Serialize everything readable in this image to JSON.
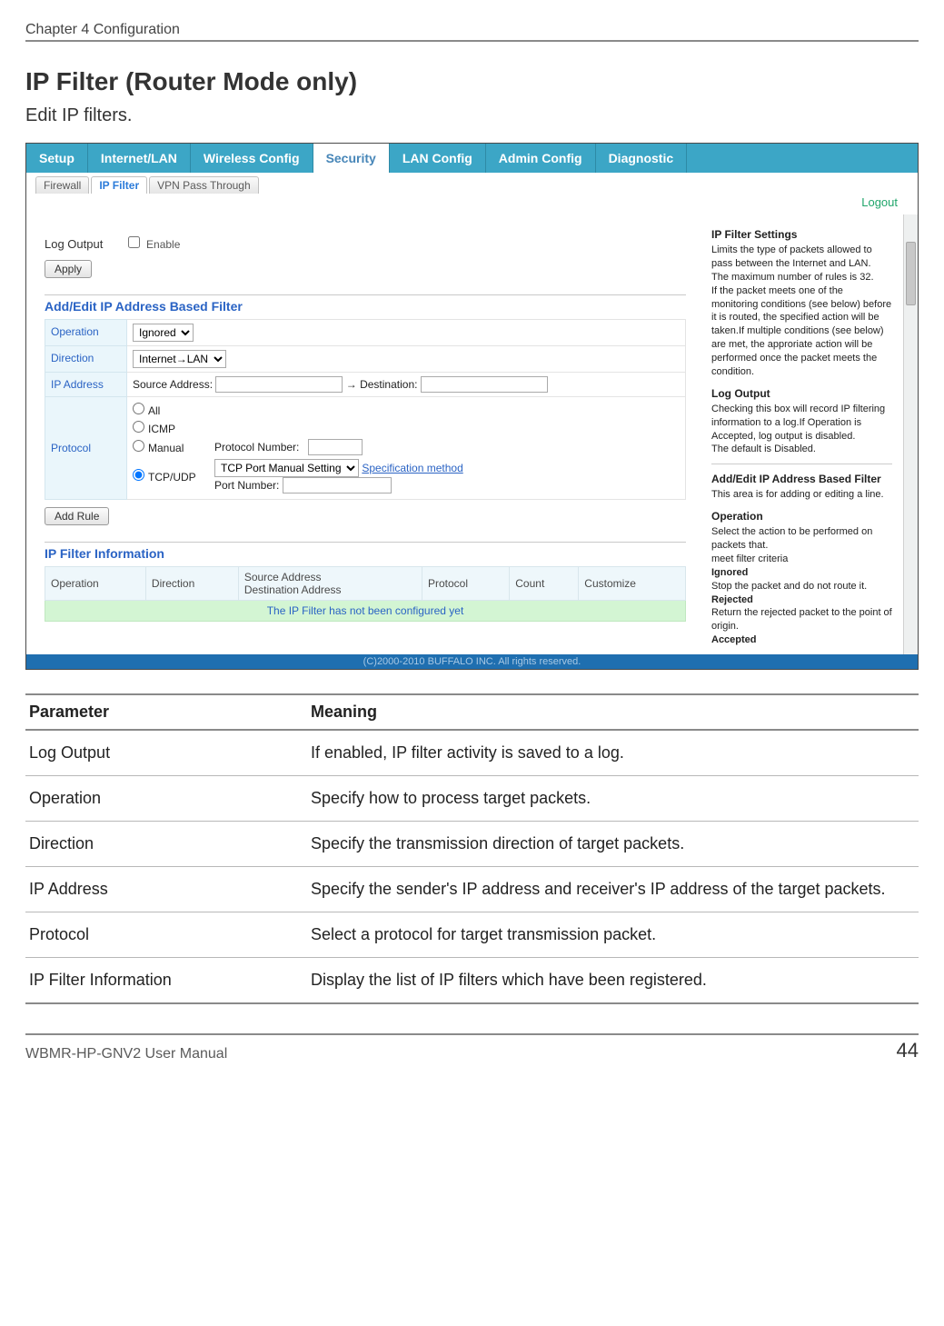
{
  "chapter": "Chapter 4  Configuration",
  "section_title": "IP Filter (Router Mode only)",
  "section_sub": "Edit IP filters.",
  "tabs": {
    "setup": "Setup",
    "internet_lan": "Internet/LAN",
    "wireless": "Wireless Config",
    "security": "Security",
    "lan": "LAN Config",
    "admin": "Admin Config",
    "diag": "Diagnostic"
  },
  "subtabs": {
    "firewall": "Firewall",
    "ipfilter": "IP Filter",
    "vpn": "VPN Pass Through"
  },
  "logout": "Logout",
  "form": {
    "log_output_label": "Log Output",
    "enable_label": "Enable",
    "apply": "Apply",
    "add_edit_head": "Add/Edit IP Address Based Filter",
    "operation_label": "Operation",
    "operation_value": "Ignored",
    "direction_label": "Direction",
    "direction_value": "Internet→LAN",
    "ipaddress_label": "IP Address",
    "source_label": "Source Address:",
    "dest_label": "→ Destination:",
    "protocol_label": "Protocol",
    "all": "All",
    "icmp": "ICMP",
    "manual": "Manual",
    "protocol_number": "Protocol Number:",
    "tcpudp": "TCP/UDP",
    "tcp_select": "TCP Port Manual Setting",
    "spec_method": "Specification method",
    "port_number": "Port Number:",
    "add_rule": "Add Rule",
    "info_head": "IP Filter Information",
    "cols": {
      "operation": "Operation",
      "direction": "Direction",
      "src_dest": "Source Address\nDestination Address",
      "protocol": "Protocol",
      "count": "Count",
      "customize": "Customize"
    },
    "not_configured": "The IP Filter has not been configured yet"
  },
  "help": {
    "h1": "IP Filter Settings",
    "p1": "Limits the type of packets allowed to pass between the Internet and LAN.",
    "p2": "The maximum number of rules is 32.",
    "p3": "If the packet meets one of the monitoring conditions (see below) before it is routed, the specified action will be taken.If multiple conditions (see below) are met, the approriate action will be performed once the packet meets the condition.",
    "h2": "Log Output",
    "p4": "Checking this box will record IP filtering information to a log.If Operation is Accepted, log output is disabled.",
    "p5": "The default is Disabled.",
    "h3": "Add/Edit IP Address Based Filter",
    "p6": "This area is for adding or editing a line.",
    "h4": "Operation",
    "p7": "Select the action to be performed on packets that.",
    "p7b": "meet filter criteria",
    "ig": "Ignored",
    "igd": "Stop the packet and do not route it.",
    "rj": "Rejected",
    "rjd": "Return the rejected packet to the point of origin.",
    "ac": "Accepted"
  },
  "copyright": "(C)2000-2010 BUFFALO INC. All rights reserved.",
  "param_table": {
    "head_param": "Parameter",
    "head_meaning": "Meaning",
    "rows": [
      {
        "p": "Log Output",
        "m": "If enabled, IP filter activity is saved to a log."
      },
      {
        "p": "Operation",
        "m": "Specify how to process target packets."
      },
      {
        "p": "Direction",
        "m": "Specify the transmission direction of target packets."
      },
      {
        "p": "IP Address",
        "m": "Specify the sender's IP address and receiver's IP address of the target packets."
      },
      {
        "p": "Protocol",
        "m": "Select a protocol for target transmission packet."
      },
      {
        "p": "IP Filter Information",
        "m": "Display the list of IP filters which have been registered."
      }
    ]
  },
  "manual": "WBMR-HP-GNV2 User Manual",
  "page_num": "44"
}
